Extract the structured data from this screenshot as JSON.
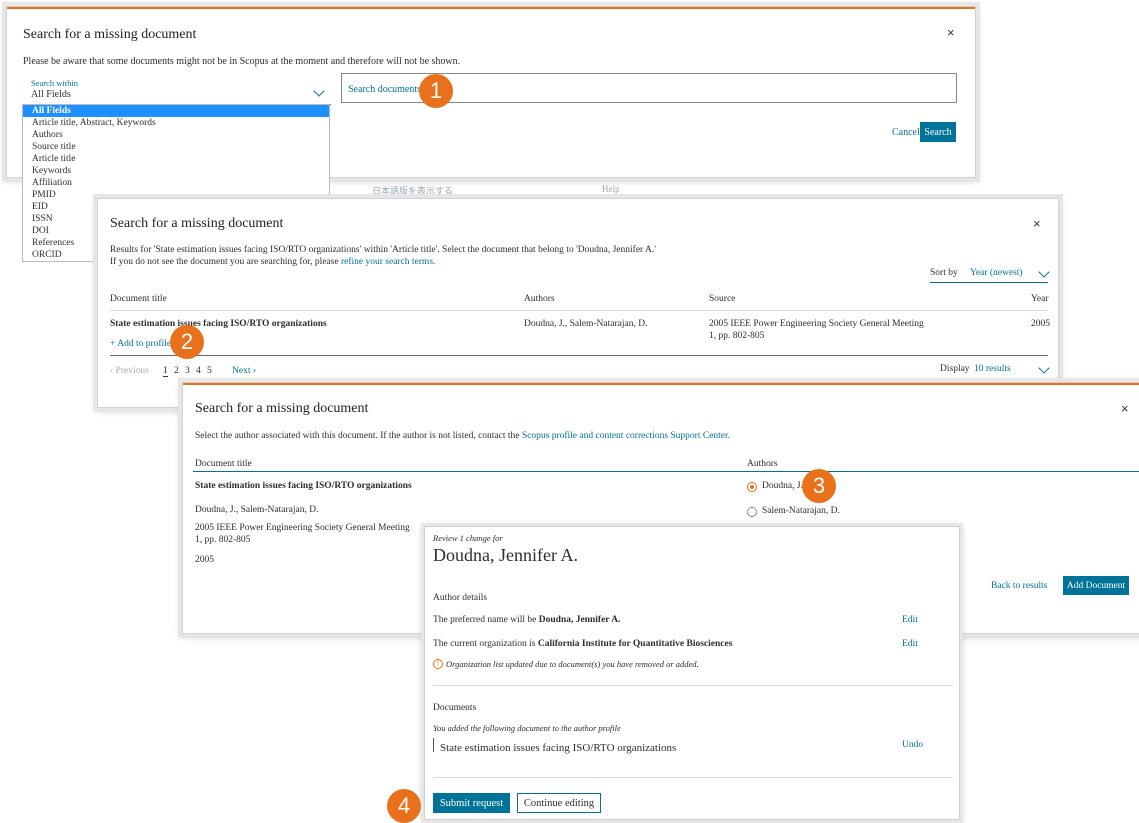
{
  "panel1": {
    "title": "Search for a missing document",
    "notice": "Please be aware that some documents might not be in Scopus at the moment and therefore will not be shown.",
    "search_within_label": "Search within",
    "search_within_value": "All Fields",
    "dropdown_options": [
      "All Fields",
      "Article title, Abstract, Keywords",
      "Authors",
      "Source title",
      "Article title",
      "Keywords",
      "Affiliation",
      "PMID",
      "EID",
      "ISSN",
      "DOI",
      "References",
      "ORCID"
    ],
    "search_placeholder": "Search documents *",
    "cancel": "Cancel",
    "search": "Search",
    "bg_lang_link": "日本語版を表示する",
    "bg_help": "Help",
    "close": "×"
  },
  "panel2": {
    "title": "Search for a missing document",
    "results_text": "Results for 'State estimation issues facing ISO/RTO organizations' within 'Article title'. Select the document that belong to 'Doudna, Jennifer A.'",
    "not_found_prefix": "If you do not see the document you are searching for, please",
    "refine_link": "refine your search terms.",
    "sort_label": "Sort by",
    "sort_value": "Year (newest)",
    "columns": [
      "Document title",
      "Authors",
      "Source",
      "Year"
    ],
    "row": {
      "title": "State estimation issues facing ISO/RTO organizations",
      "authors": "Doudna, J., Salem-Natarajan, D.",
      "source_line1": "2005 IEEE Power Engineering Society General Meeting",
      "source_line2": "1, pp. 802-805",
      "year": "2005"
    },
    "add_to_profile": "+ Add to profile",
    "previous": "‹ Previous",
    "pages": [
      "1",
      "2",
      "3",
      "4",
      "5"
    ],
    "next": "Next ›",
    "display_label": "Display",
    "display_value": "10 results",
    "close": "×"
  },
  "panel3": {
    "title": "Search for a missing document",
    "instruction_prefix": "Select the author associated with this document. If the author is not listed, contact the",
    "support_link": "Scopus profile and content corrections Support Center.",
    "col_title": "Document title",
    "col_authors": "Authors",
    "doc_title": "State estimation issues facing ISO/RTO organizations",
    "doc_authors": "Doudna, J., Salem-Natarajan, D.",
    "doc_source1": "2005 IEEE Power Engineering Society General Meeting",
    "doc_source2": "1, pp. 802-805",
    "doc_year": "2005",
    "author_options": [
      "Doudna, J.",
      "Salem-Natarajan, D."
    ],
    "selected_author": "Doudna, J.",
    "back_to_results": "Back to results",
    "add_document": "Add Document",
    "close": "×"
  },
  "review": {
    "subtitle": "Review 1 change for",
    "name": "Doudna, Jennifer A.",
    "author_details_heading": "Author details",
    "preferred_prefix": "The preferred name will be",
    "preferred_name": "Doudna, Jennifer A.",
    "org_prefix": "The current organization is",
    "org_name": "California Institute for Quantitative Biosciences",
    "edit": "Edit",
    "org_notice": "Organization list updated due to document(s) you have removed or added.",
    "documents_heading": "Documents",
    "added_text": "You added the following document to the author profile",
    "added_doc": "State estimation issues facing ISO/RTO organizations",
    "undo": "Undo",
    "submit": "Submit request",
    "continue": "Continue editing"
  },
  "badges": [
    "1",
    "2",
    "3",
    "4"
  ],
  "colors": {
    "accent": "#e9711c",
    "link": "#007398",
    "selected": "#1e90ff"
  }
}
